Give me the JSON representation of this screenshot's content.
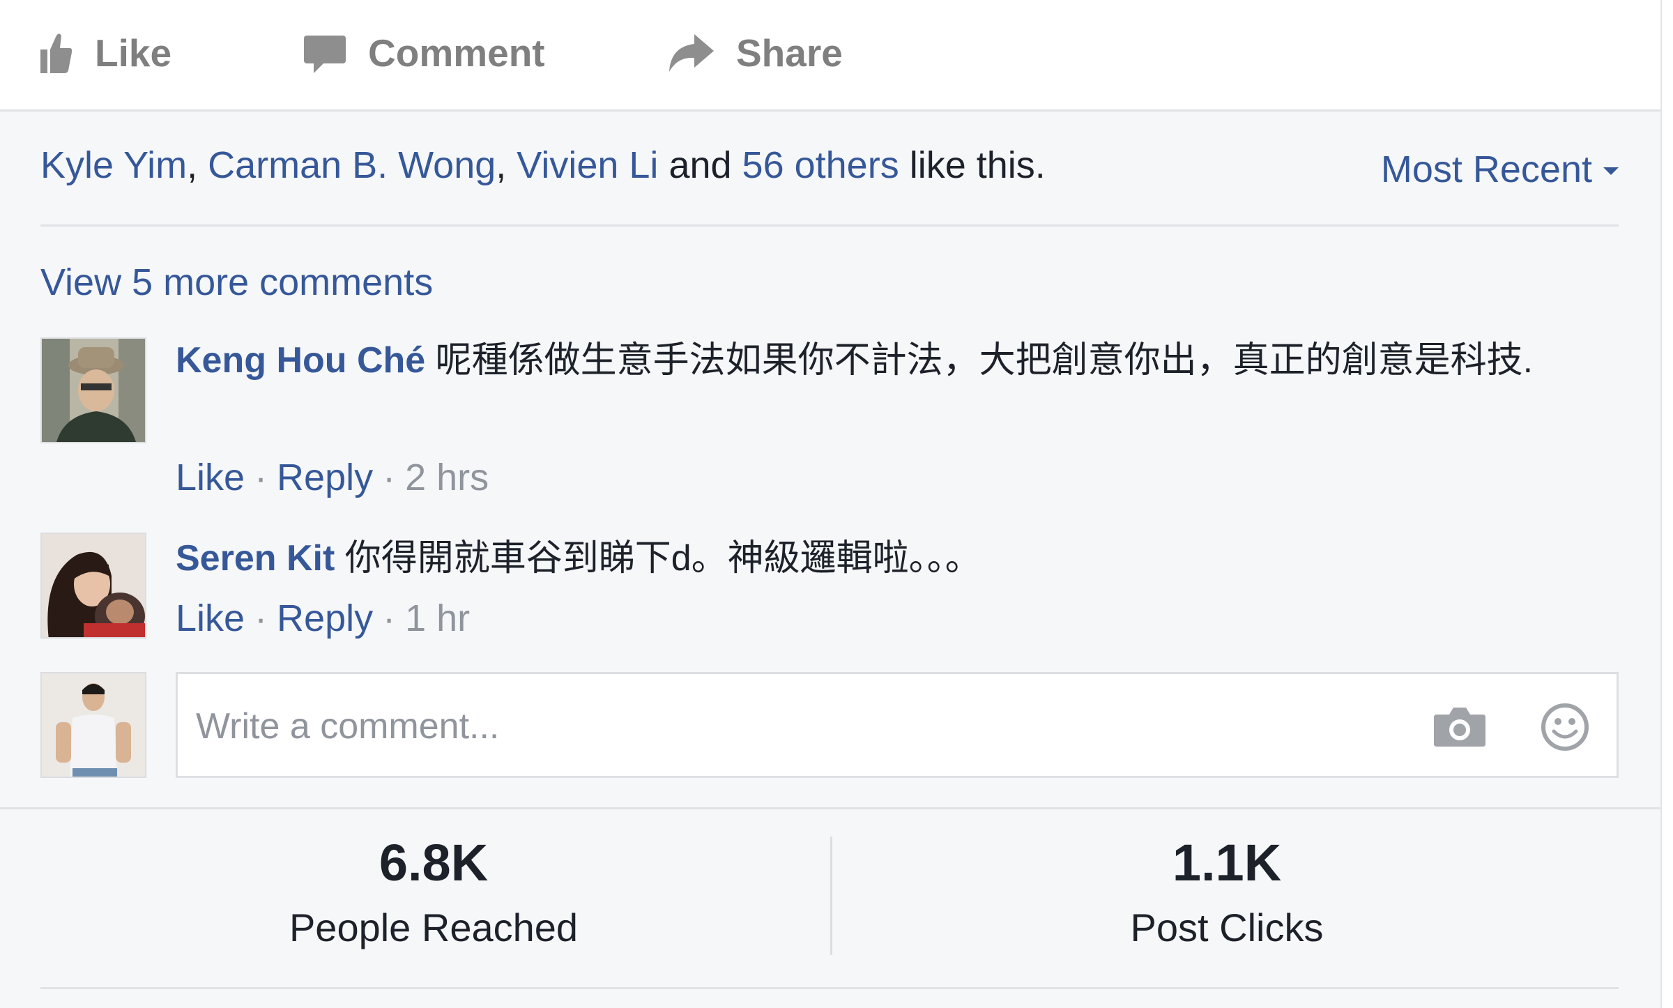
{
  "actions": {
    "like": "Like",
    "comment": "Comment",
    "share": "Share"
  },
  "likes_line": {
    "name1": "Kyle Yim",
    "sep1": ", ",
    "name2": "Carman B. Wong",
    "sep2": ", ",
    "name3": "Vivien Li",
    "and": " and ",
    "others": "56 others",
    "suffix": " like this."
  },
  "sort": {
    "label": "Most Recent"
  },
  "view_more": "View 5 more comments",
  "comments": [
    {
      "author": "Keng Hou Ché",
      "text": "呢種係做生意手法如果你不計法，大把創意你出，真正的創意是科技.",
      "like": "Like",
      "reply": "Reply",
      "time": "2 hrs",
      "dot": "·"
    },
    {
      "author": "Seren Kit",
      "text": "你得開就車谷到睇下d。神級邏輯啦。。。",
      "like": "Like",
      "reply": "Reply",
      "time": "1 hr",
      "dot": "·"
    }
  ],
  "composer": {
    "placeholder": "Write a comment..."
  },
  "stats": [
    {
      "value": "6.8K",
      "label": "People Reached"
    },
    {
      "value": "1.1K",
      "label": "Post Clicks"
    }
  ],
  "colors": {
    "link": "#365899",
    "action_gray": "#7f7f7f",
    "meta_gray": "#90949c",
    "text": "#1d2129",
    "panel_bg": "#f6f7f9"
  },
  "icons": {
    "like": "thumbs-up-icon",
    "comment": "speech-bubble-icon",
    "share": "share-arrow-icon",
    "camera": "camera-icon",
    "emoji": "smiley-icon",
    "sort_caret": "caret-down-icon"
  }
}
